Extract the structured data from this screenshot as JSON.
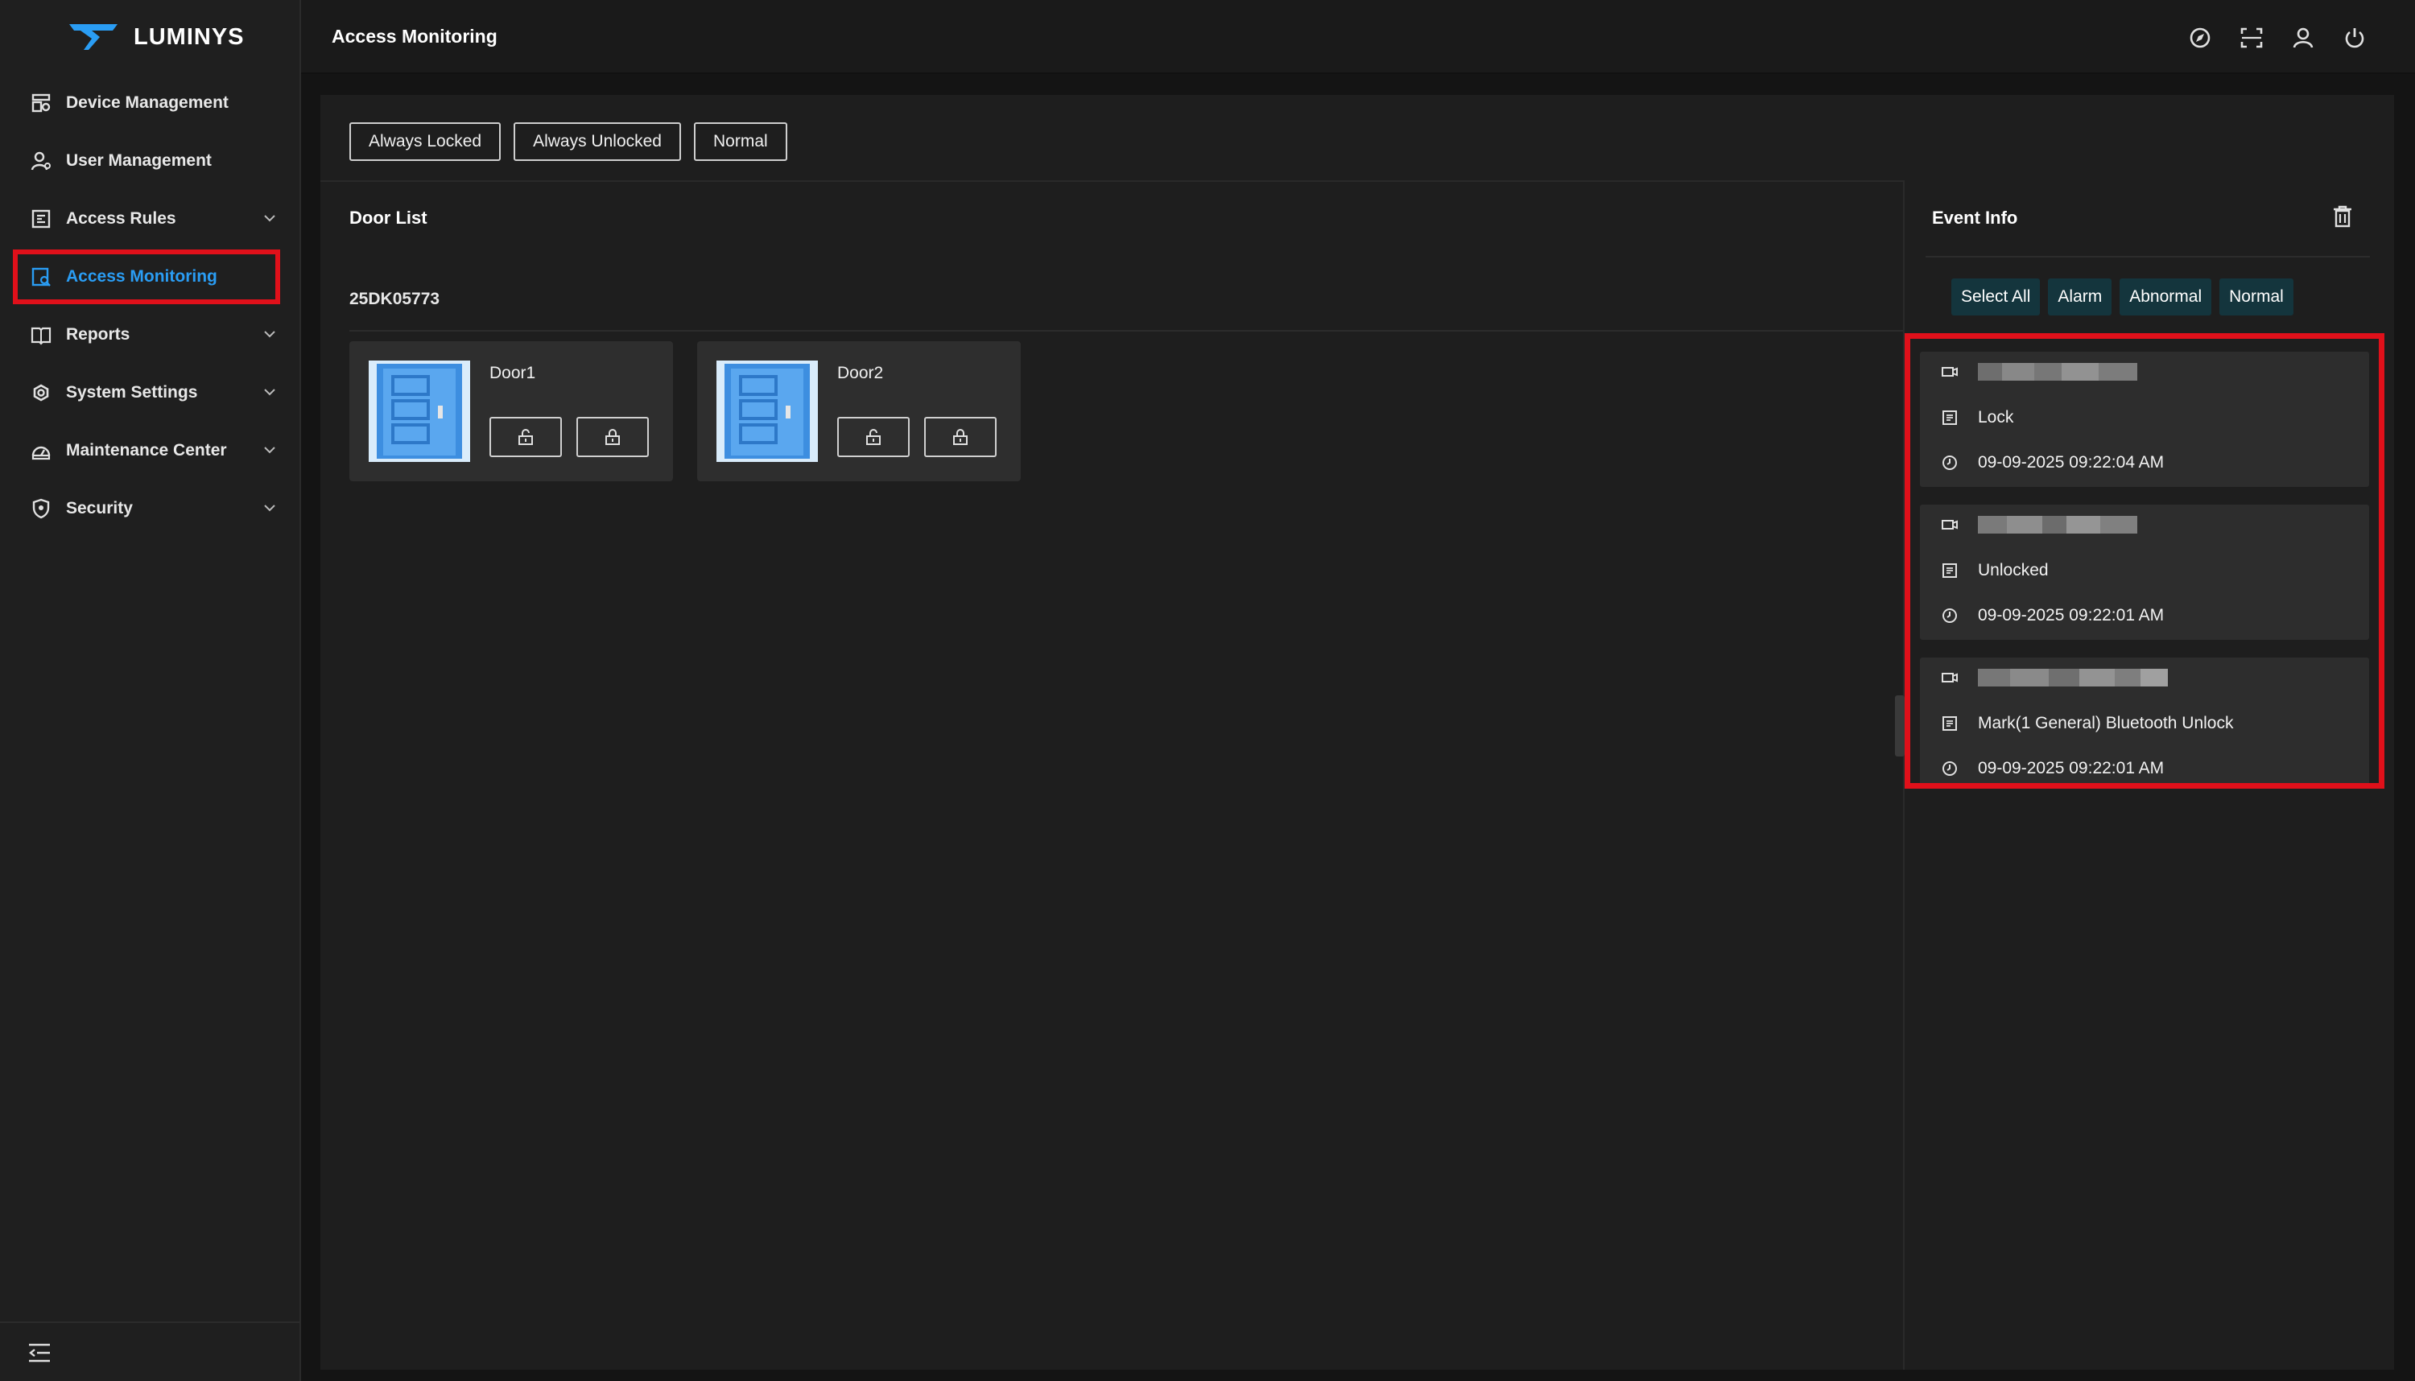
{
  "brand": {
    "name": "LUMINYS",
    "color": "#2a9df4"
  },
  "sidebar": {
    "items": [
      {
        "label": "Device Management",
        "icon": "device-management-icon",
        "expandable": false
      },
      {
        "label": "User Management",
        "icon": "user-management-icon",
        "expandable": false
      },
      {
        "label": "Access Rules",
        "icon": "access-rules-icon",
        "expandable": true
      },
      {
        "label": "Access Monitoring",
        "icon": "access-monitoring-icon",
        "expandable": false,
        "active": true
      },
      {
        "label": "Reports",
        "icon": "reports-icon",
        "expandable": true
      },
      {
        "label": "System Settings",
        "icon": "gear-icon",
        "expandable": true
      },
      {
        "label": "Maintenance Center",
        "icon": "maintenance-icon",
        "expandable": true
      },
      {
        "label": "Security",
        "icon": "shield-icon",
        "expandable": true
      }
    ]
  },
  "header": {
    "title": "Access Monitoring",
    "icons": [
      "compass-icon",
      "fullscreen-icon",
      "user-icon",
      "power-icon"
    ]
  },
  "toolbar": {
    "always_locked": "Always Locked",
    "always_unlocked": "Always Unlocked",
    "normal": "Normal"
  },
  "door_list": {
    "title": "Door List",
    "device": "25DK05773",
    "doors": [
      {
        "name": "Door1"
      },
      {
        "name": "Door2"
      }
    ]
  },
  "event_info": {
    "title": "Event Info",
    "filters": [
      "Select All",
      "Alarm",
      "Abnormal",
      "Normal"
    ],
    "events": [
      {
        "type": "Lock",
        "time": "09-09-2025 09:22:04 AM"
      },
      {
        "type": "Unlocked",
        "time": "09-09-2025 09:22:01 AM"
      },
      {
        "type": "Mark(1 General) Bluetooth Unlock",
        "time": "09-09-2025 09:22:01 AM"
      }
    ]
  },
  "colors": {
    "accent": "#2a9df4",
    "highlight": "#e0101a",
    "filter_bg": "#14353d"
  }
}
